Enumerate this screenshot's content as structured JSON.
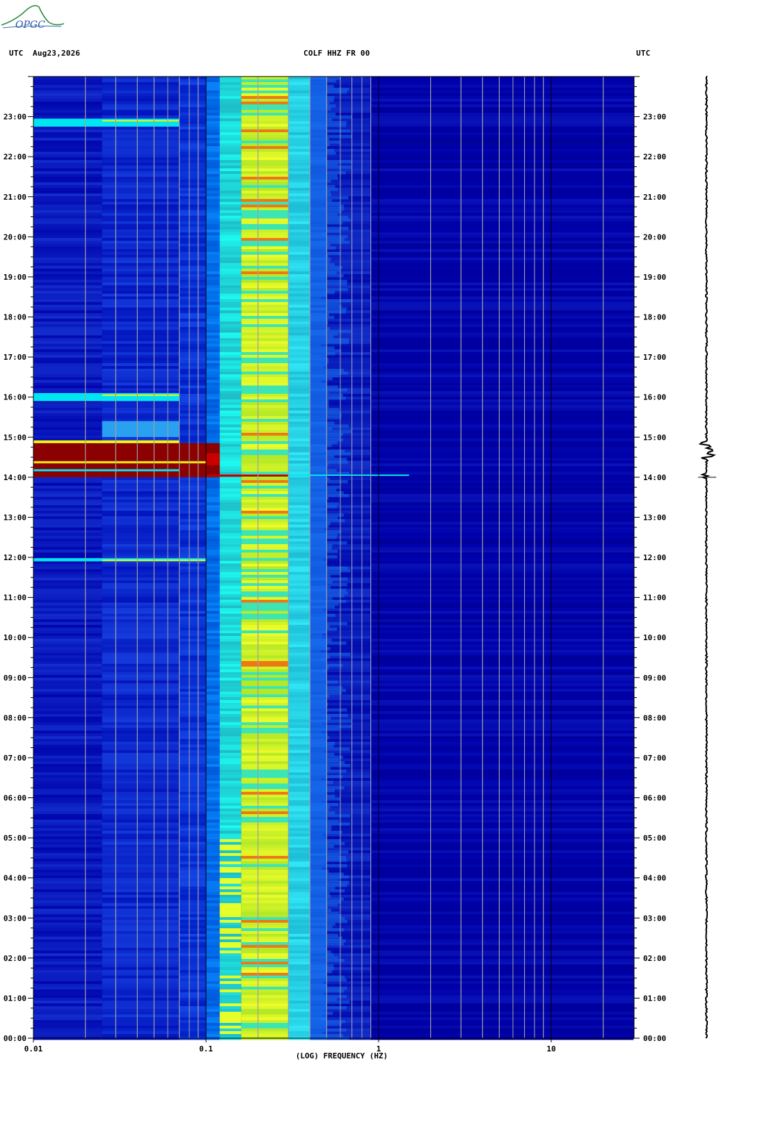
{
  "logo": {
    "text": "OPGC"
  },
  "header": {
    "left_tz": "UTC",
    "date": "Aug23,2026",
    "station": "COLF HHZ FR 00",
    "right_tz": "UTC"
  },
  "colors": {
    "background": "#0000aa",
    "low": "#0a22c8",
    "cyan": "#00e6f0",
    "yellow": "#f5f50a",
    "red": "#c80000",
    "darkred": "#8b0000"
  },
  "chart_data": {
    "type": "heatmap",
    "title": "COLF HHZ FR 00",
    "xlabel": "(LOG) FREQUENCY (HZ)",
    "ylabel": "UTC",
    "x_scale": "log",
    "xlim": [
      0.01,
      30
    ],
    "ylim_hours": [
      0,
      24
    ],
    "x_ticks": [
      {
        "value": 0.01,
        "label": "0.01"
      },
      {
        "value": 0.1,
        "label": "0.1"
      },
      {
        "value": 1,
        "label": "1"
      },
      {
        "value": 10,
        "label": "10"
      }
    ],
    "y_ticks": [
      {
        "hour": 0,
        "label": "00:00"
      },
      {
        "hour": 1,
        "label": "01:00"
      },
      {
        "hour": 2,
        "label": "02:00"
      },
      {
        "hour": 3,
        "label": "03:00"
      },
      {
        "hour": 4,
        "label": "04:00"
      },
      {
        "hour": 5,
        "label": "05:00"
      },
      {
        "hour": 6,
        "label": "06:00"
      },
      {
        "hour": 7,
        "label": "07:00"
      },
      {
        "hour": 8,
        "label": "08:00"
      },
      {
        "hour": 9,
        "label": "09:00"
      },
      {
        "hour": 10,
        "label": "10:00"
      },
      {
        "hour": 11,
        "label": "11:00"
      },
      {
        "hour": 12,
        "label": "12:00"
      },
      {
        "hour": 13,
        "label": "13:00"
      },
      {
        "hour": 14,
        "label": "14:00"
      },
      {
        "hour": 15,
        "label": "15:00"
      },
      {
        "hour": 16,
        "label": "16:00"
      },
      {
        "hour": 17,
        "label": "17:00"
      },
      {
        "hour": 18,
        "label": "18:00"
      },
      {
        "hour": 19,
        "label": "19:00"
      },
      {
        "hour": 20,
        "label": "20:00"
      },
      {
        "hour": 21,
        "label": "21:00"
      },
      {
        "hour": 22,
        "label": "22:00"
      },
      {
        "hour": 23,
        "label": "23:00"
      }
    ],
    "microseism_band_hz": [
      0.12,
      0.45
    ],
    "microseism_peak_hz": [
      0.18,
      0.3
    ],
    "event_hour_range": [
      14.0,
      14.85
    ],
    "event_max_hz": 0.12,
    "event_line_hour": 14.05,
    "event_line_max_hz": 1.5,
    "bands": [
      {
        "hour_start": 11.9,
        "hour_end": 11.98,
        "max_hz": 0.1,
        "level": "cyan"
      },
      {
        "hour_start": 15.9,
        "hour_end": 16.1,
        "max_hz": 0.07,
        "level": "cyan"
      },
      {
        "hour_start": 22.75,
        "hour_end": 22.95,
        "max_hz": 0.07,
        "level": "cyan"
      }
    ]
  }
}
